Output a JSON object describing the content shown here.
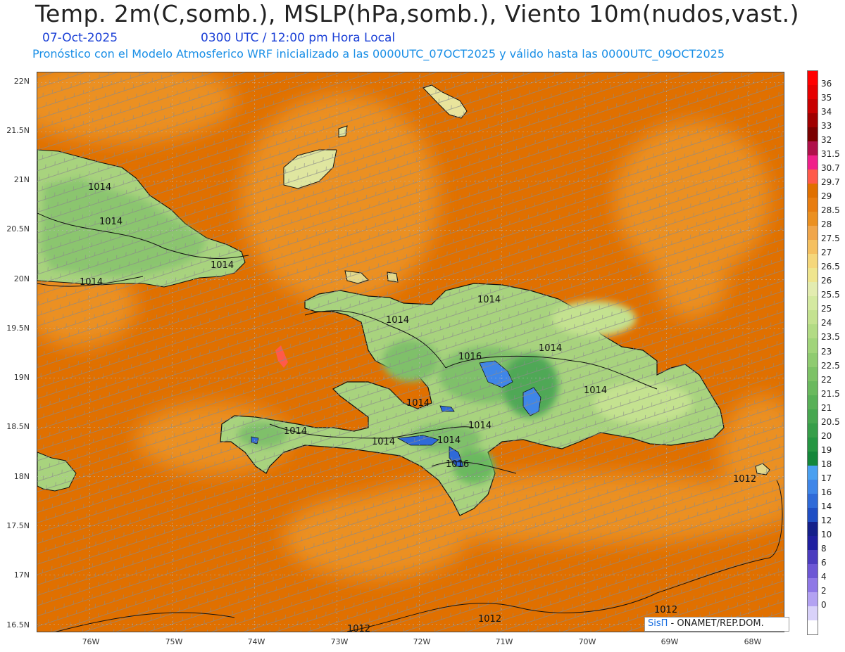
{
  "title": "Temp. 2m(C,somb.), MSLP(hPa,somb.), Viento 10m(nudos,vast.)",
  "date": "07-Oct-2025",
  "time": "0300 UTC / 12:00 pm Hora Local",
  "description": "Pronóstico con el Modelo Atmosferico WRF inicializado a las 0000UTC_07OCT2025 y válido hasta las  0000UTC_09OCT2025",
  "credit": {
    "brand": "SisΠ",
    "text": " - ONAMET/REP.DOM."
  },
  "lat_labels": [
    "22N",
    "21.5N",
    "21N",
    "20.5N",
    "20N",
    "19.5N",
    "19N",
    "18.5N",
    "18N",
    "17.5N",
    "17N",
    "16.5N"
  ],
  "lon_labels": [
    "76W",
    "75W",
    "74W",
    "73W",
    "72W",
    "71W",
    "70W",
    "69W",
    "68W"
  ],
  "isobar_labels": [
    "1014",
    "1014",
    "1014",
    "1014",
    "1014",
    "1014",
    "1014",
    "1014",
    "1014",
    "1014",
    "1014",
    "1014",
    "1014",
    "1014",
    "1016",
    "1016",
    "1012",
    "1012",
    "1012",
    "1012"
  ],
  "colorbar": {
    "labels": [
      "36",
      "35",
      "34",
      "33",
      "32",
      "31.5",
      "30.7",
      "29.7",
      "29",
      "28.5",
      "28",
      "27.5",
      "27",
      "26.5",
      "26",
      "25.5",
      "25",
      "24",
      "23.5",
      "23",
      "22.5",
      "22",
      "21.5",
      "21",
      "20.5",
      "20",
      "19",
      "18",
      "17",
      "16",
      "14",
      "12",
      "10",
      "8",
      "6",
      "4",
      "2",
      "0"
    ],
    "colors": [
      "#ff0000",
      "#e60000",
      "#c80000",
      "#a00000",
      "#7a0000",
      "#b0104a",
      "#f0208a",
      "#ff5a4a",
      "#e07000",
      "#e87d10",
      "#eb9020",
      "#f0a64b",
      "#f5c060",
      "#f5d77b",
      "#efe58e",
      "#e3ecb0",
      "#d4e9a0",
      "#c4e290",
      "#b2db84",
      "#a1d47a",
      "#8fcb70",
      "#7dc266",
      "#6ab95e",
      "#58b057",
      "#47a750",
      "#369e49",
      "#259642",
      "#14873a",
      "#4aa0f0",
      "#3f86e8",
      "#2f6ad8",
      "#1f4ec4",
      "#14208a",
      "#2020a0",
      "#4b3cbf",
      "#6d57d5",
      "#8f78e6",
      "#b3a2f2",
      "#d9d2fa",
      "#ffffff"
    ]
  },
  "colors": {
    "sea_warm": "#e07000",
    "sea_lighter": "#eb9020",
    "land_green": "#a8d37e",
    "land_dark": "#3ea152",
    "highland_blue": "#3f86e8",
    "barb": "#8a8a8a"
  }
}
